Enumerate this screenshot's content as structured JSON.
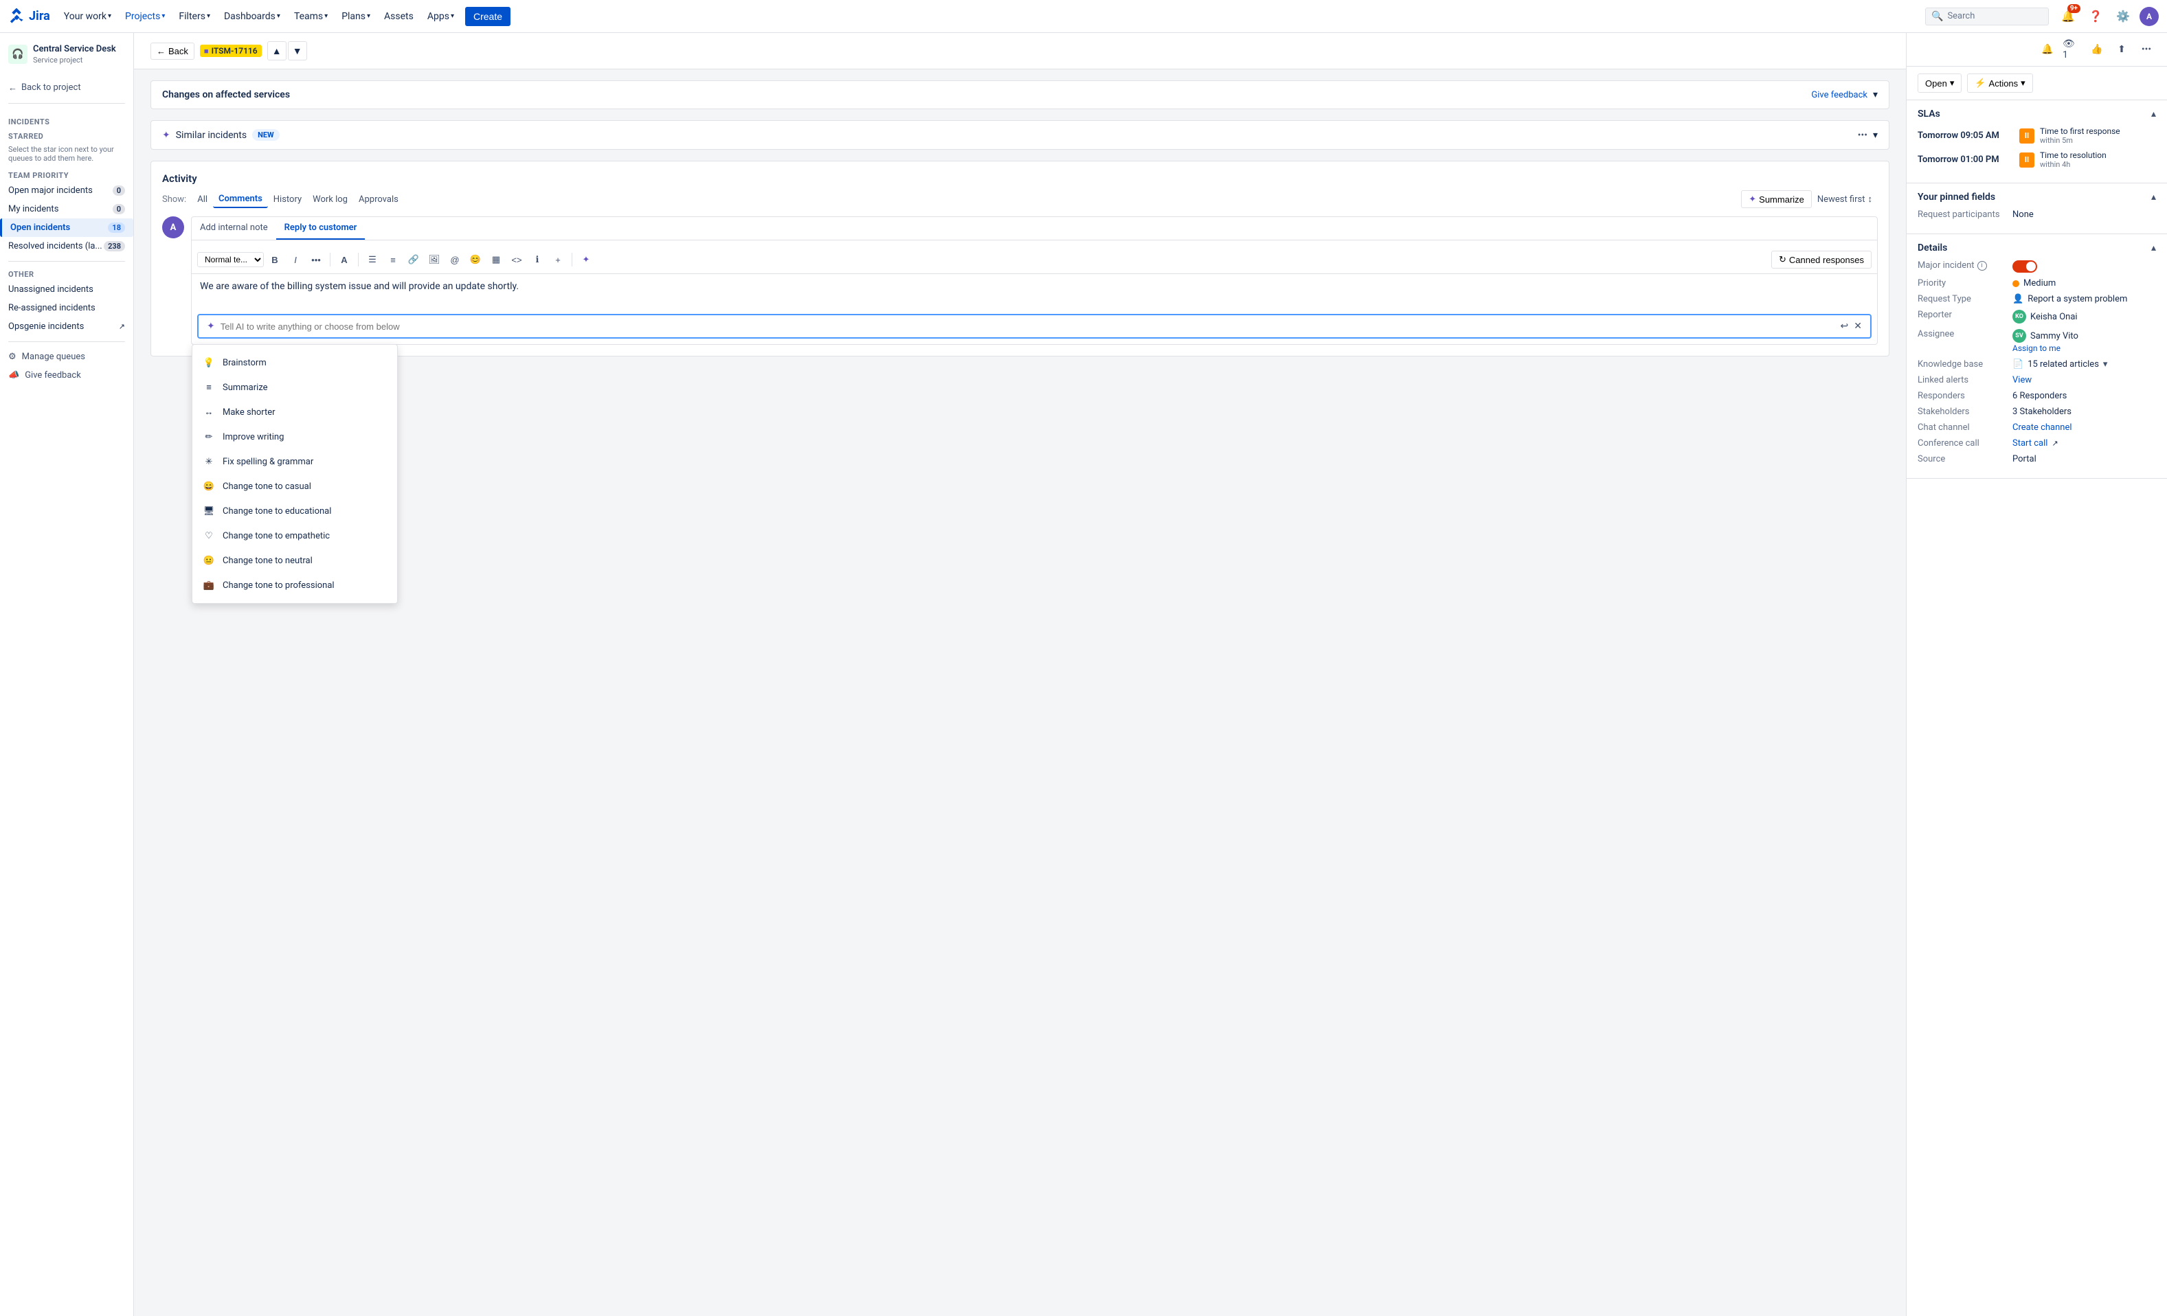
{
  "topnav": {
    "logo_text": "Jira",
    "your_work": "Your work",
    "projects": "Projects",
    "filters": "Filters",
    "dashboards": "Dashboards",
    "teams": "Teams",
    "plans": "Plans",
    "assets": "Assets",
    "apps": "Apps",
    "create": "Create",
    "search_placeholder": "Search",
    "notification_count": "9+"
  },
  "sidebar": {
    "project_name": "Central Service Desk",
    "project_type": "Service project",
    "back_to_project": "Back to project",
    "incidents_title": "Incidents",
    "starred_title": "STARRED",
    "starred_hint": "Select the star icon next to your queues to add them here.",
    "team_priority_title": "TEAM PRIORITY",
    "open_major_incidents": "Open major incidents",
    "open_major_count": "0",
    "my_incidents": "My incidents",
    "my_incidents_count": "0",
    "open_incidents": "Open incidents",
    "open_incidents_count": "18",
    "resolved_incidents": "Resolved incidents (la...",
    "resolved_count": "238",
    "other_title": "OTHER",
    "unassigned_incidents": "Unassigned incidents",
    "reassigned_incidents": "Re-assigned incidents",
    "opsgenie_incidents": "Opsgenie incidents",
    "manage_queues": "Manage queues",
    "give_feedback": "Give feedback"
  },
  "issue_header": {
    "back": "Back",
    "issue_id": "ITSM-17116"
  },
  "info_banner": {
    "title": "Changes on affected services",
    "give_feedback": "Give feedback"
  },
  "similar_incidents": {
    "label": "Similar incidents",
    "badge": "NEW"
  },
  "activity": {
    "title": "Activity",
    "show_label": "Show:",
    "tabs": [
      "All",
      "Comments",
      "History",
      "Work log",
      "Approvals"
    ],
    "active_tab": "Comments",
    "summarize": "Summarize",
    "newest_first": "Newest first",
    "add_internal_note": "Add internal note",
    "reply_to_customer": "Reply to customer",
    "editor_content": "We are aware of the billing system issue and will provide an update shortly.",
    "ai_placeholder": "Tell AI to write anything or choose from below",
    "canned_responses": "Canned responses"
  },
  "ai_menu": {
    "items": [
      {
        "icon": "bulb",
        "label": "Brainstorm"
      },
      {
        "icon": "list",
        "label": "Summarize"
      },
      {
        "icon": "short",
        "label": "Make shorter"
      },
      {
        "icon": "pen",
        "label": "Improve writing"
      },
      {
        "icon": "sparkle",
        "label": "Fix spelling & grammar"
      },
      {
        "icon": "smile",
        "label": "Change tone to casual"
      },
      {
        "icon": "book",
        "label": "Change tone to educational"
      },
      {
        "icon": "heart",
        "label": "Change tone to empathetic"
      },
      {
        "icon": "neutral",
        "label": "Change tone to neutral"
      },
      {
        "icon": "briefcase",
        "label": "Change tone to professional"
      }
    ]
  },
  "right_panel": {
    "status": "Open",
    "actions": "Actions",
    "slas_title": "SLAs",
    "sla1_time": "Tomorrow 09:05 AM",
    "sla1_desc_line1": "Time to first response",
    "sla1_desc_line2": "within 5m",
    "sla2_time": "Tomorrow 01:00 PM",
    "sla2_desc_line1": "Time to resolution",
    "sla2_desc_line2": "within 4h",
    "pinned_fields_title": "Your pinned fields",
    "request_participants_label": "Request participants",
    "request_participants_value": "None",
    "details_title": "Details",
    "major_incident_label": "Major incident",
    "priority_label": "Priority",
    "priority_value": "Medium",
    "request_type_label": "Request Type",
    "request_type_value": "Report a system problem",
    "reporter_label": "Reporter",
    "reporter_value": "Keisha Onai",
    "assignee_label": "Assignee",
    "assignee_value": "Sammy Vito",
    "assign_to_me": "Assign to me",
    "knowledge_base_label": "Knowledge base",
    "knowledge_base_value": "15 related articles",
    "linked_alerts_label": "Linked alerts",
    "linked_alerts_value": "View",
    "responders_label": "Responders",
    "responders_value": "6 Responders",
    "stakeholders_label": "Stakeholders",
    "stakeholders_value": "3 Stakeholders",
    "chat_channel_label": "Chat channel",
    "chat_channel_value": "Create channel",
    "conference_call_label": "Conference call",
    "conference_call_value": "Start call",
    "source_label": "Source",
    "source_value": "Portal"
  }
}
